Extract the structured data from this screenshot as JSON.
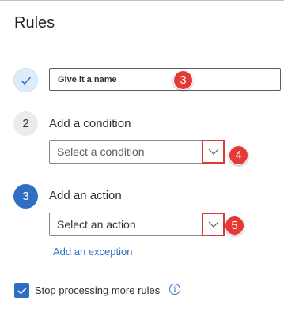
{
  "panel": {
    "title": "Rules"
  },
  "steps": [
    {
      "number": "",
      "label": ""
    },
    {
      "number": "2",
      "label": "Add a condition"
    },
    {
      "number": "3",
      "label": "Add an action"
    }
  ],
  "name_field": {
    "value": "Give it a name"
  },
  "condition_dropdown": {
    "placeholder": "Select a condition"
  },
  "action_dropdown": {
    "placeholder": "Select an action"
  },
  "exception_link": "Add an exception",
  "stop_processing": {
    "label": "Stop processing more rules",
    "checked": true
  },
  "annotations": [
    "3",
    "4",
    "5"
  ],
  "colors": {
    "accent": "#2f6fc3",
    "annotation": "#e53935",
    "link": "#2b6fc2"
  }
}
